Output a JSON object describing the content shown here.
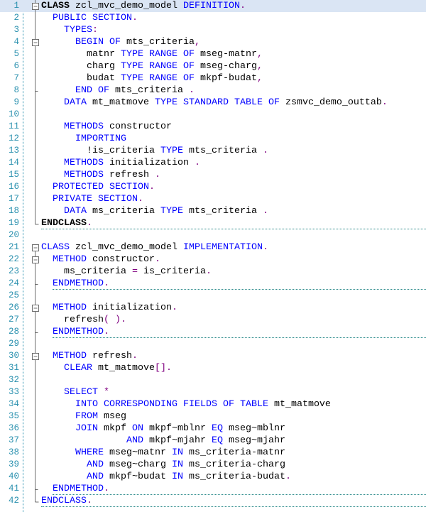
{
  "editor": {
    "language": "ABAP",
    "colors": {
      "keyword": "#0000ff",
      "identifier": "#000000",
      "punctuation": "#800080",
      "line_number": "#2b91af",
      "current_line": "#dae5f4",
      "separator": "#2b8a8a"
    },
    "current_line": 1,
    "lines": [
      {
        "n": "1",
        "fold": "open",
        "sep": false,
        "indent": 0,
        "tokens": [
          [
            "b",
            "CLASS"
          ],
          [
            "id",
            " zcl_mvc_demo_model "
          ],
          [
            "kw",
            "DEFINITION"
          ],
          [
            "p",
            "."
          ]
        ]
      },
      {
        "n": "2",
        "fold": "line",
        "sep": false,
        "indent": 2,
        "tokens": [
          [
            "kw",
            "PUBLIC SECTION"
          ],
          [
            "p",
            "."
          ]
        ]
      },
      {
        "n": "3",
        "fold": "line",
        "sep": false,
        "indent": 4,
        "tokens": [
          [
            "kw",
            "TYPES"
          ],
          [
            "p",
            ":"
          ]
        ]
      },
      {
        "n": "4",
        "fold": "open",
        "sep": false,
        "indent": 6,
        "tokens": [
          [
            "kw",
            "BEGIN OF"
          ],
          [
            "id",
            " mts_criteria"
          ],
          [
            "p",
            ","
          ]
        ]
      },
      {
        "n": "5",
        "fold": "line",
        "sep": false,
        "indent": 8,
        "tokens": [
          [
            "id",
            "matnr "
          ],
          [
            "kw",
            "TYPE RANGE OF"
          ],
          [
            "id",
            " mseg-matnr"
          ],
          [
            "p",
            ","
          ]
        ]
      },
      {
        "n": "6",
        "fold": "line",
        "sep": false,
        "indent": 8,
        "tokens": [
          [
            "id",
            "charg "
          ],
          [
            "kw",
            "TYPE RANGE OF"
          ],
          [
            "id",
            " mseg-charg"
          ],
          [
            "p",
            ","
          ]
        ]
      },
      {
        "n": "7",
        "fold": "line",
        "sep": false,
        "indent": 8,
        "tokens": [
          [
            "id",
            "budat "
          ],
          [
            "kw",
            "TYPE RANGE OF"
          ],
          [
            "id",
            " mkpf-budat"
          ],
          [
            "p",
            ","
          ]
        ]
      },
      {
        "n": "8",
        "fold": "inner-end",
        "sep": false,
        "indent": 6,
        "tokens": [
          [
            "kw",
            "END OF"
          ],
          [
            "id",
            " mts_criteria "
          ],
          [
            "p",
            "."
          ]
        ]
      },
      {
        "n": "9",
        "fold": "line",
        "sep": false,
        "indent": 4,
        "tokens": [
          [
            "kw",
            "DATA"
          ],
          [
            "id",
            " mt_matmove "
          ],
          [
            "kw",
            "TYPE STANDARD TABLE OF"
          ],
          [
            "id",
            " zsmvc_demo_outtab"
          ],
          [
            "p",
            "."
          ]
        ]
      },
      {
        "n": "10",
        "fold": "line",
        "sep": false,
        "indent": 0,
        "tokens": []
      },
      {
        "n": "11",
        "fold": "line",
        "sep": false,
        "indent": 4,
        "tokens": [
          [
            "kw",
            "METHODS"
          ],
          [
            "id",
            " constructor"
          ]
        ]
      },
      {
        "n": "12",
        "fold": "line",
        "sep": false,
        "indent": 6,
        "tokens": [
          [
            "kw",
            "IMPORTING"
          ]
        ]
      },
      {
        "n": "13",
        "fold": "line",
        "sep": false,
        "indent": 8,
        "tokens": [
          [
            "id",
            "!is_criteria "
          ],
          [
            "kw",
            "TYPE"
          ],
          [
            "id",
            " mts_criteria "
          ],
          [
            "p",
            "."
          ]
        ]
      },
      {
        "n": "14",
        "fold": "line",
        "sep": false,
        "indent": 4,
        "tokens": [
          [
            "kw",
            "METHODS"
          ],
          [
            "id",
            " initialization "
          ],
          [
            "p",
            "."
          ]
        ]
      },
      {
        "n": "15",
        "fold": "line",
        "sep": false,
        "indent": 4,
        "tokens": [
          [
            "kw",
            "METHODS"
          ],
          [
            "id",
            " refresh "
          ],
          [
            "p",
            "."
          ]
        ]
      },
      {
        "n": "16",
        "fold": "line",
        "sep": false,
        "indent": 2,
        "tokens": [
          [
            "kw",
            "PROTECTED SECTION"
          ],
          [
            "p",
            "."
          ]
        ]
      },
      {
        "n": "17",
        "fold": "line",
        "sep": false,
        "indent": 2,
        "tokens": [
          [
            "kw",
            "PRIVATE SECTION"
          ],
          [
            "p",
            "."
          ]
        ]
      },
      {
        "n": "18",
        "fold": "line",
        "sep": false,
        "indent": 4,
        "tokens": [
          [
            "kw",
            "DATA"
          ],
          [
            "id",
            " ms_criteria "
          ],
          [
            "kw",
            "TYPE"
          ],
          [
            "id",
            " mts_criteria "
          ],
          [
            "p",
            "."
          ]
        ]
      },
      {
        "n": "19",
        "fold": "end",
        "sep": true,
        "indent": 0,
        "tokens": [
          [
            "b",
            "ENDCLASS"
          ],
          [
            "p",
            "."
          ]
        ]
      },
      {
        "n": "20",
        "fold": "none",
        "sep": false,
        "indent": 0,
        "tokens": []
      },
      {
        "n": "21",
        "fold": "open-top",
        "sep": false,
        "indent": 0,
        "tokens": [
          [
            "kw",
            "CLASS"
          ],
          [
            "id",
            " zcl_mvc_demo_model "
          ],
          [
            "kw",
            "IMPLEMENTATION"
          ],
          [
            "p",
            "."
          ]
        ]
      },
      {
        "n": "22",
        "fold": "open",
        "sep": false,
        "indent": 2,
        "tokens": [
          [
            "kw",
            "METHOD"
          ],
          [
            "id",
            " constructor"
          ],
          [
            "p",
            "."
          ]
        ]
      },
      {
        "n": "23",
        "fold": "line",
        "sep": false,
        "indent": 4,
        "tokens": [
          [
            "id",
            "ms_criteria "
          ],
          [
            "p",
            "="
          ],
          [
            "id",
            " is_criteria"
          ],
          [
            "p",
            "."
          ]
        ]
      },
      {
        "n": "24",
        "fold": "inner-end",
        "sep": true,
        "indent": 2,
        "tokens": [
          [
            "kw",
            "ENDMETHOD"
          ],
          [
            "p",
            "."
          ]
        ]
      },
      {
        "n": "25",
        "fold": "line",
        "sep": false,
        "indent": 0,
        "tokens": []
      },
      {
        "n": "26",
        "fold": "open",
        "sep": false,
        "indent": 2,
        "tokens": [
          [
            "kw",
            "METHOD"
          ],
          [
            "id",
            " initialization"
          ],
          [
            "p",
            "."
          ]
        ]
      },
      {
        "n": "27",
        "fold": "line",
        "sep": false,
        "indent": 4,
        "tokens": [
          [
            "id",
            "refresh"
          ],
          [
            "p",
            "( )."
          ]
        ]
      },
      {
        "n": "28",
        "fold": "inner-end",
        "sep": true,
        "indent": 2,
        "tokens": [
          [
            "kw",
            "ENDMETHOD"
          ],
          [
            "p",
            "."
          ]
        ]
      },
      {
        "n": "29",
        "fold": "line",
        "sep": false,
        "indent": 0,
        "tokens": []
      },
      {
        "n": "30",
        "fold": "open",
        "sep": false,
        "indent": 2,
        "tokens": [
          [
            "kw",
            "METHOD"
          ],
          [
            "id",
            " refresh"
          ],
          [
            "p",
            "."
          ]
        ]
      },
      {
        "n": "31",
        "fold": "line",
        "sep": false,
        "indent": 4,
        "tokens": [
          [
            "kw",
            "CLEAR"
          ],
          [
            "id",
            " mt_matmove"
          ],
          [
            "p",
            "[]."
          ]
        ]
      },
      {
        "n": "32",
        "fold": "line",
        "sep": false,
        "indent": 0,
        "tokens": []
      },
      {
        "n": "33",
        "fold": "line",
        "sep": false,
        "indent": 4,
        "tokens": [
          [
            "kw",
            "SELECT"
          ],
          [
            "id",
            " "
          ],
          [
            "p",
            "*"
          ]
        ]
      },
      {
        "n": "34",
        "fold": "line",
        "sep": false,
        "indent": 6,
        "tokens": [
          [
            "kw",
            "INTO CORRESPONDING FIELDS OF TABLE"
          ],
          [
            "id",
            " mt_matmove"
          ]
        ]
      },
      {
        "n": "35",
        "fold": "line",
        "sep": false,
        "indent": 6,
        "tokens": [
          [
            "kw",
            "FROM"
          ],
          [
            "id",
            " mseg"
          ]
        ]
      },
      {
        "n": "36",
        "fold": "line",
        "sep": false,
        "indent": 6,
        "tokens": [
          [
            "kw",
            "JOIN"
          ],
          [
            "id",
            " mkpf "
          ],
          [
            "kw",
            "ON"
          ],
          [
            "id",
            " mkpf~mblnr "
          ],
          [
            "kw",
            "EQ"
          ],
          [
            "id",
            " mseg~mblnr"
          ]
        ]
      },
      {
        "n": "37",
        "fold": "line",
        "sep": false,
        "indent": 15,
        "tokens": [
          [
            "kw",
            "AND"
          ],
          [
            "id",
            " mkpf~mjahr "
          ],
          [
            "kw",
            "EQ"
          ],
          [
            "id",
            " mseg~mjahr"
          ]
        ]
      },
      {
        "n": "38",
        "fold": "line",
        "sep": false,
        "indent": 6,
        "tokens": [
          [
            "kw",
            "WHERE"
          ],
          [
            "id",
            " mseg~matnr "
          ],
          [
            "kw",
            "IN"
          ],
          [
            "id",
            " ms_criteria-matnr"
          ]
        ]
      },
      {
        "n": "39",
        "fold": "line",
        "sep": false,
        "indent": 8,
        "tokens": [
          [
            "kw",
            "AND"
          ],
          [
            "id",
            " mseg~charg "
          ],
          [
            "kw",
            "IN"
          ],
          [
            "id",
            " ms_criteria-charg"
          ]
        ]
      },
      {
        "n": "40",
        "fold": "line",
        "sep": false,
        "indent": 8,
        "tokens": [
          [
            "kw",
            "AND"
          ],
          [
            "id",
            " mkpf~budat "
          ],
          [
            "kw",
            "IN"
          ],
          [
            "id",
            " ms_criteria-budat"
          ],
          [
            "p",
            "."
          ]
        ]
      },
      {
        "n": "41",
        "fold": "inner-end",
        "sep": true,
        "indent": 2,
        "tokens": [
          [
            "kw",
            "ENDMETHOD"
          ],
          [
            "p",
            "."
          ]
        ]
      },
      {
        "n": "42",
        "fold": "end",
        "sep": true,
        "indent": 0,
        "tokens": [
          [
            "kw",
            "ENDCLASS"
          ],
          [
            "p",
            "."
          ]
        ]
      }
    ]
  }
}
